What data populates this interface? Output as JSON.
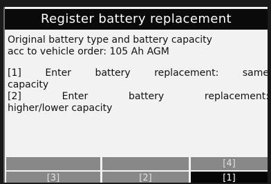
{
  "header": {
    "title": "Register battery replacement"
  },
  "main": {
    "info_line_1": "Original battery type and battery capacity",
    "info_line_2": "acc to vehicle order: 105 Ah AGM",
    "option_1_line_1": "[1] Enter battery replacement: same",
    "option_1_line_2": "capacity",
    "option_2_line_1": "[2] Enter battery replacement:",
    "option_2_line_2": "higher/lower capacity"
  },
  "softkeys": {
    "row1_col1": "",
    "row1_col2": "",
    "row1_col3": "[4]",
    "row2_col1": "[3]",
    "row2_col2": "[2]",
    "row2_col3": "[1]"
  },
  "colors": {
    "title_bg": "#0a0a0a",
    "display_bg": "#f2f2f2",
    "softkey_grey": "#888888",
    "softkey_selected": "#050505"
  }
}
